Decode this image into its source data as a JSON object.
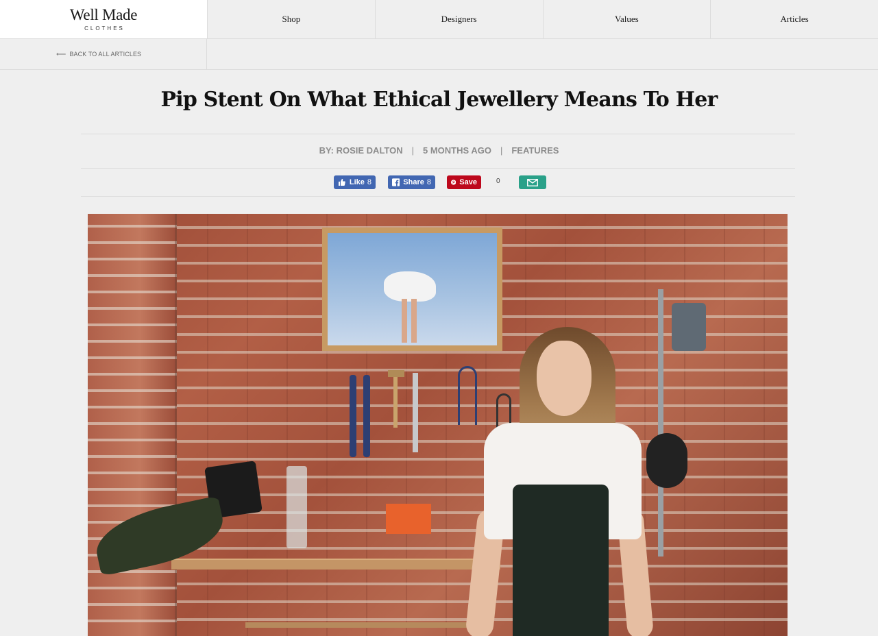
{
  "header": {
    "logo_main": "Well Made",
    "logo_sub": "CLOTHES",
    "nav": [
      "Shop",
      "Designers",
      "Values",
      "Articles"
    ]
  },
  "subbar": {
    "back_label": "BACK TO ALL ARTICLES"
  },
  "article": {
    "title": "Pip Stent On What Ethical Jewellery Means To Her",
    "author": "BY: ROSIE DALTON",
    "time": "5 MONTHS AGO",
    "category": "FEATURES"
  },
  "share": {
    "like_label": "Like",
    "like_count": "8",
    "share_label": "Share",
    "share_count": "8",
    "pin_label": "Save",
    "pin_count": "0"
  },
  "colors": {
    "facebook": "#4267b2",
    "pinterest": "#bd081c",
    "email": "#2aa189"
  }
}
